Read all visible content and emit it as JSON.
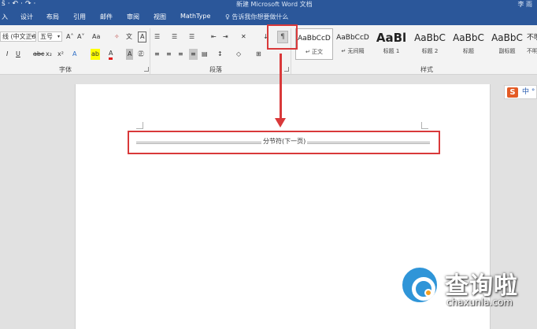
{
  "window": {
    "quick_access": "ŝ·↶·↷·",
    "title": "新建 Microsoft Word 文档",
    "user": "李 雨"
  },
  "tabs": [
    "入",
    "设计",
    "布局",
    "引用",
    "邮件",
    "审阅",
    "视图",
    "MathType"
  ],
  "tell_me": "♀ 告诉我你想要做什么",
  "font_group": {
    "label": "字体",
    "font_name": "线 (中文正3",
    "font_size": "五号",
    "grow": "A˄",
    "shrink": "A˅",
    "change_case": "Aa",
    "clear_format": "✧",
    "phonetic": "文",
    "border_char": "A",
    "italic": "I",
    "underline": "U",
    "strike": "abc",
    "subscript": "x₂",
    "superscript": "x²",
    "text_effect": "A",
    "highlight": "ab",
    "font_color": "A",
    "shading": "A",
    "enclose": "㊣"
  },
  "paragraph_group": {
    "label": "段落",
    "bullets": "☰",
    "numbering": "☰",
    "multilevel": "☰",
    "decrease_indent": "⇤",
    "increase_indent": "⇥",
    "asian_layout": "✕",
    "sort": "↓",
    "show_marks": "¶",
    "align_left": "≡",
    "center": "≡",
    "align_right": "≡",
    "justify": "≡",
    "distribute": "▤",
    "line_spacing": "↕",
    "shading": "◇",
    "borders": "⊞"
  },
  "styles_group": {
    "label": "样式",
    "items": [
      {
        "sample": "AaBbCcD",
        "name": "↵ 正文"
      },
      {
        "sample": "AaBbCcD",
        "name": "↵ 无间隔"
      },
      {
        "sample": "AaBl",
        "name": "标题 1"
      },
      {
        "sample": "AaBbC",
        "name": "标题 2"
      },
      {
        "sample": "AaBbC",
        "name": "标题"
      },
      {
        "sample": "AaBbC",
        "name": "副标题"
      },
      {
        "sample": "不明",
        "name": "不明"
      }
    ]
  },
  "document": {
    "section_break_label": "分节符(下一页)"
  },
  "ime": {
    "logo": "S",
    "mode": "中 °"
  },
  "watermark": {
    "text": "查询啦",
    "url": "chaxunla.com"
  },
  "colors": {
    "ribbon_blue": "#2b579a",
    "annotation_red": "#d9393a"
  }
}
